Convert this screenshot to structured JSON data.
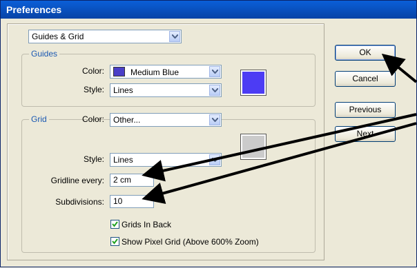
{
  "window": {
    "title": "Preferences"
  },
  "section_select": {
    "value": "Guides & Grid"
  },
  "guides": {
    "legend": "Guides",
    "color_label": "Color:",
    "color_value": "Medium Blue",
    "color_swatch": "#4a3fc8",
    "preview_color": "#4c3cf4",
    "style_label": "Style:",
    "style_value": "Lines"
  },
  "grid": {
    "legend": "Grid",
    "color_label": "Color:",
    "color_value": "Other...",
    "preview_color": "#cbcbcb",
    "style_label": "Style:",
    "style_value": "Lines",
    "gridline_label": "Gridline every:",
    "gridline_value": "2 cm",
    "subdivisions_label": "Subdivisions:",
    "subdivisions_value": "10",
    "grids_in_back_label": "Grids In Back",
    "grids_in_back_checked": true,
    "pixel_grid_label": "Show Pixel Grid (Above 600% Zoom)",
    "pixel_grid_checked": true
  },
  "buttons": {
    "ok": "OK",
    "cancel": "Cancel",
    "previous": "Previous",
    "next": "Next"
  }
}
